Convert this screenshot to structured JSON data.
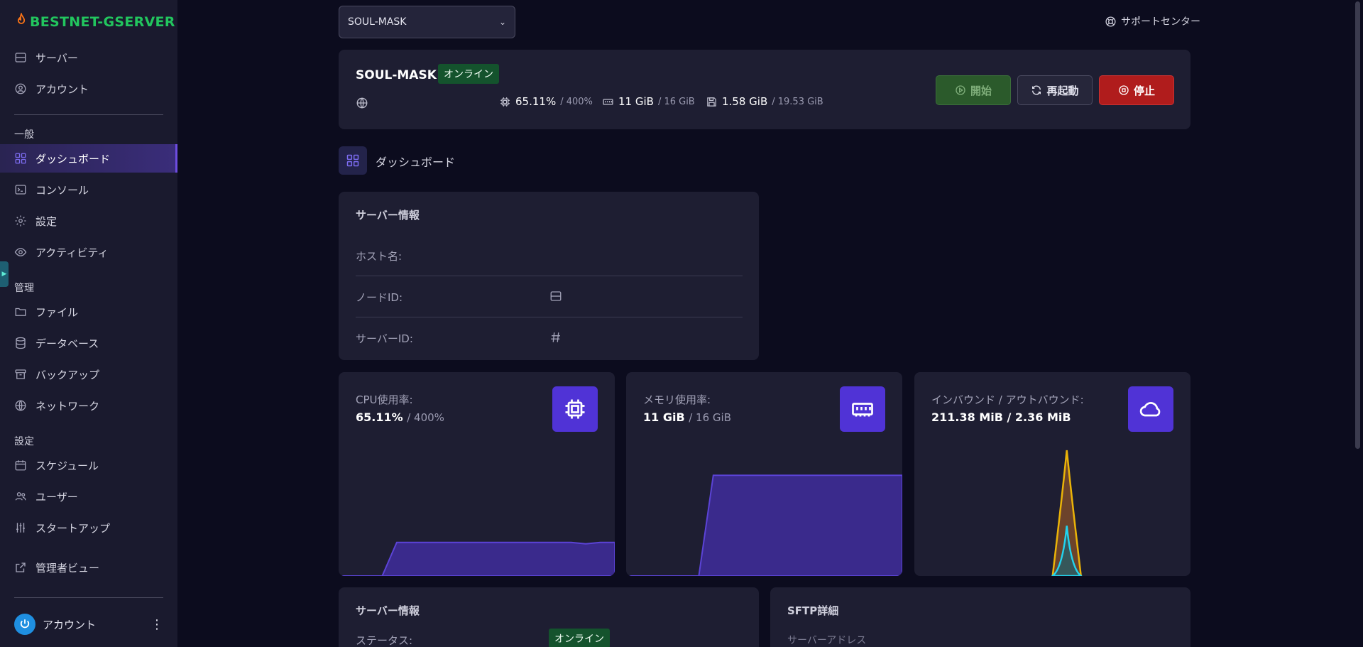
{
  "sidebar": {
    "logo": "BESTNET-GSERVER",
    "top_items": [
      {
        "label": "サーバー",
        "icon": "server-icon"
      },
      {
        "label": "アカウント",
        "icon": "user-circle-icon"
      }
    ],
    "section_general": "一般",
    "general_items": [
      {
        "label": "ダッシュボード",
        "icon": "grid-icon",
        "active": true
      },
      {
        "label": "コンソール",
        "icon": "terminal-icon"
      },
      {
        "label": "設定",
        "icon": "gear-icon"
      },
      {
        "label": "アクティビティ",
        "icon": "eye-icon"
      }
    ],
    "section_manage": "管理",
    "manage_items": [
      {
        "label": "ファイル",
        "icon": "folder-icon"
      },
      {
        "label": "データベース",
        "icon": "database-icon"
      },
      {
        "label": "バックアップ",
        "icon": "archive-icon"
      },
      {
        "label": "ネットワーク",
        "icon": "globe-icon"
      }
    ],
    "section_settings": "設定",
    "settings_items": [
      {
        "label": "スケジュール",
        "icon": "calendar-icon"
      },
      {
        "label": "ユーザー",
        "icon": "users-icon"
      },
      {
        "label": "スタートアップ",
        "icon": "sliders-icon"
      }
    ],
    "admin_view": "管理者ビュー",
    "account_label": "アカウント",
    "accent_color": "#6d4ce0"
  },
  "topbar": {
    "server_select": "SOUL-MASK",
    "support": "サポートセンター"
  },
  "header": {
    "server_name": "SOUL-MASK",
    "status": "オンライン",
    "cpu": "65.11%",
    "cpu_limit": "/ 400%",
    "memory": "11 GiB",
    "memory_limit": "/ 16 GiB",
    "disk": "1.58 GiB",
    "disk_limit": "/ 19.53 GiB",
    "btn_start": "開始",
    "btn_restart": "再起動",
    "btn_stop": "停止"
  },
  "dashboard_title": "ダッシュボード",
  "server_info": {
    "title": "サーバー情報",
    "hostname_label": "ホスト名:",
    "node_label": "ノードID:",
    "server_id_label": "サーバーID:"
  },
  "metrics": {
    "cpu": {
      "label": "CPU使用率:",
      "value": "65.11%",
      "limit": "/ 400%"
    },
    "memory": {
      "label": "メモリ使用率:",
      "value": "11 GiB",
      "limit": "/ 16 GiB"
    },
    "network": {
      "label": "インバウンド / アウトバウンド:",
      "value": "211.38 MiB / 2.36 MiB"
    }
  },
  "chart_data": [
    {
      "type": "area",
      "name": "cpu",
      "values": [
        0,
        0,
        0,
        0,
        24,
        24,
        24,
        24,
        24,
        24,
        24,
        24,
        24,
        24,
        24,
        24,
        24,
        23,
        24,
        24
      ],
      "ylim": [
        0,
        100
      ],
      "color": "#5b43d6"
    },
    {
      "type": "area",
      "name": "memory",
      "values": [
        0,
        0,
        0,
        0,
        0,
        0,
        72,
        72,
        72,
        72,
        72,
        72,
        72,
        72,
        72,
        72,
        72,
        72,
        72,
        72
      ],
      "ylim": [
        0,
        100
      ],
      "color": "#5b43d6"
    },
    {
      "type": "line",
      "name": "network",
      "series": [
        {
          "values": [
            0,
            0,
            0,
            0,
            0,
            0,
            0,
            0,
            0,
            0,
            100,
            0,
            0,
            0,
            0,
            0,
            0,
            0,
            0,
            0
          ],
          "color": "#eab308"
        },
        {
          "values": [
            0,
            0,
            0,
            0,
            0,
            0,
            0,
            0,
            0,
            0,
            40,
            0,
            0,
            0,
            0,
            0,
            0,
            0,
            0,
            0
          ],
          "color": "#22d3ee"
        }
      ],
      "ylim": [
        0,
        100
      ]
    }
  ],
  "bottom": {
    "info_title": "サーバー情報",
    "status_label": "ステータス:",
    "status_value": "オンライン",
    "sftp_title": "SFTP詳細",
    "sftp_address": "サーバーアドレス"
  }
}
